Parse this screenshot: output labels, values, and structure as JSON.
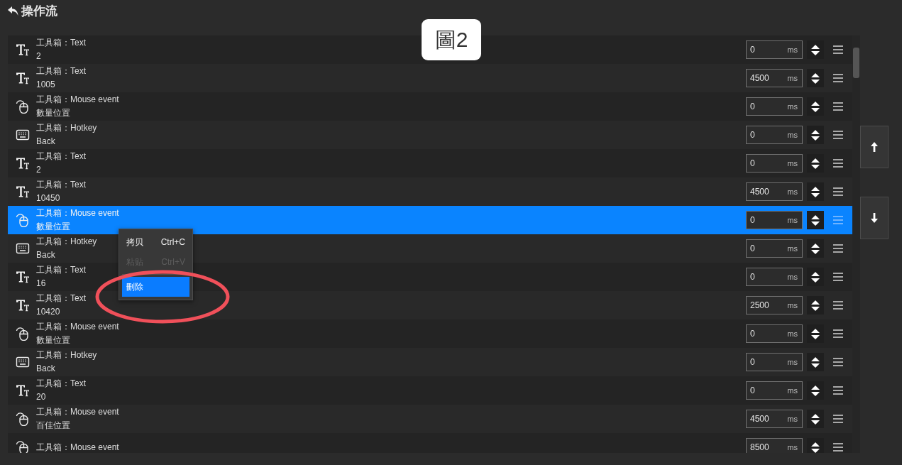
{
  "header": {
    "title": "操作流"
  },
  "figure_label": "圖2",
  "rows": [
    {
      "kind": "text",
      "title": "工具箱：Text",
      "subtitle": "2",
      "delay": "0",
      "unit": "ms",
      "selected": false
    },
    {
      "kind": "text",
      "title": "工具箱：Text",
      "subtitle": "1005",
      "delay": "4500",
      "unit": "ms",
      "selected": false
    },
    {
      "kind": "mouse",
      "title": "工具箱：Mouse event",
      "subtitle": "數量位置",
      "delay": "0",
      "unit": "ms",
      "selected": false
    },
    {
      "kind": "hotkey",
      "title": "工具箱：Hotkey",
      "subtitle": "Back",
      "delay": "0",
      "unit": "ms",
      "selected": false
    },
    {
      "kind": "text",
      "title": "工具箱：Text",
      "subtitle": "2",
      "delay": "0",
      "unit": "ms",
      "selected": false
    },
    {
      "kind": "text",
      "title": "工具箱：Text",
      "subtitle": "10450",
      "delay": "4500",
      "unit": "ms",
      "selected": false
    },
    {
      "kind": "mouse",
      "title": "工具箱：Mouse event",
      "subtitle": "數量位置",
      "delay": "0",
      "unit": "ms",
      "selected": true
    },
    {
      "kind": "hotkey",
      "title": "工具箱：Hotkey",
      "subtitle": "Back",
      "delay": "0",
      "unit": "ms",
      "selected": false
    },
    {
      "kind": "text",
      "title": "工具箱：Text",
      "subtitle": "16",
      "delay": "0",
      "unit": "ms",
      "selected": false
    },
    {
      "kind": "text",
      "title": "工具箱：Text",
      "subtitle": "10420",
      "delay": "2500",
      "unit": "ms",
      "selected": false
    },
    {
      "kind": "mouse",
      "title": "工具箱：Mouse event",
      "subtitle": "數量位置",
      "delay": "0",
      "unit": "ms",
      "selected": false
    },
    {
      "kind": "hotkey",
      "title": "工具箱：Hotkey",
      "subtitle": "Back",
      "delay": "0",
      "unit": "ms",
      "selected": false
    },
    {
      "kind": "text",
      "title": "工具箱：Text",
      "subtitle": "20",
      "delay": "0",
      "unit": "ms",
      "selected": false
    },
    {
      "kind": "mouse",
      "title": "工具箱：Mouse event",
      "subtitle": "百佳位置",
      "delay": "4500",
      "unit": "ms",
      "selected": false
    },
    {
      "kind": "mouse",
      "title": "工具箱：Mouse event",
      "delay": "8500",
      "unit": "ms",
      "selected": false
    }
  ],
  "context_menu": {
    "groups": [
      {
        "items": [
          {
            "label": "拷贝",
            "shortcut": "Ctrl+C",
            "disabled": false,
            "selected": false
          },
          {
            "label": "粘贴",
            "shortcut": "Ctrl+V",
            "disabled": true,
            "selected": false
          }
        ]
      },
      {
        "items": [
          {
            "label": "刪除",
            "disabled": false,
            "selected": true
          }
        ]
      }
    ]
  }
}
